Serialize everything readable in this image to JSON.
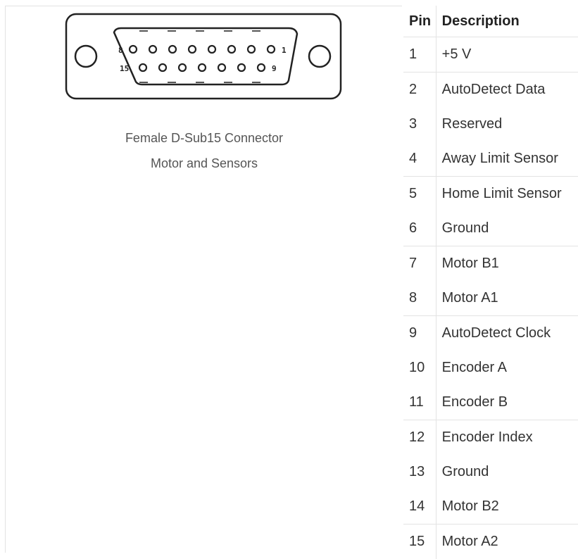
{
  "connector": {
    "row_top_left_label": "8",
    "row_top_right_label": "1",
    "row_bottom_left_label": "15",
    "row_bottom_right_label": "9",
    "caption_line1": "Female D-Sub15 Connector",
    "caption_line2": "Motor and Sensors"
  },
  "table": {
    "headers": [
      "Pin",
      "Description"
    ],
    "rows": [
      {
        "pin": "1",
        "description": "+5 V"
      },
      {
        "pin": "2",
        "description": "AutoDetect Data"
      },
      {
        "pin": "3",
        "description": "Reserved"
      },
      {
        "pin": "4",
        "description": "Away Limit Sensor"
      },
      {
        "pin": "5",
        "description": "Home Limit Sensor"
      },
      {
        "pin": "6",
        "description": "Ground"
      },
      {
        "pin": "7",
        "description": "Motor B1"
      },
      {
        "pin": "8",
        "description": "Motor A1"
      },
      {
        "pin": "9",
        "description": "AutoDetect Clock"
      },
      {
        "pin": "10",
        "description": "Encoder A"
      },
      {
        "pin": "11",
        "description": "Encoder B"
      },
      {
        "pin": "12",
        "description": "Encoder Index"
      },
      {
        "pin": "13",
        "description": "Ground"
      },
      {
        "pin": "14",
        "description": "Motor B2"
      },
      {
        "pin": "15",
        "description": "Motor A2"
      }
    ]
  }
}
